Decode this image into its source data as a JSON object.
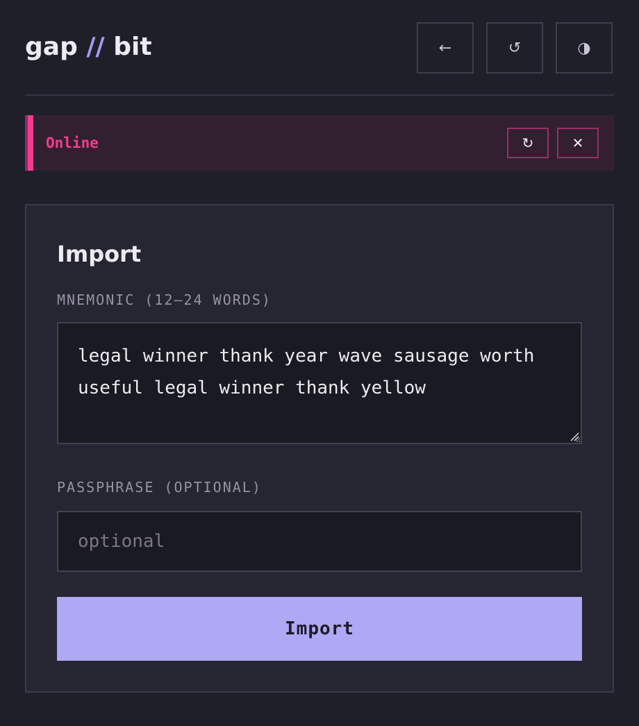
{
  "header": {
    "brand": {
      "left": "gap",
      "separator": "//",
      "right": "bit"
    },
    "buttons": [
      {
        "icon": "arrow-left-icon",
        "glyph": "←"
      },
      {
        "icon": "undo-icon",
        "glyph": "↺"
      },
      {
        "icon": "half-circle-theme-icon",
        "glyph": "◑"
      }
    ]
  },
  "banner": {
    "status": "Online",
    "refresh_glyph": "↻",
    "close_glyph": "✕",
    "accent_color": "#f03d8e"
  },
  "form": {
    "title": "Import",
    "mnemonic_label": "MNEMONIC (12–24 WORDS)",
    "mnemonic_value": "legal winner thank year wave sausage worth useful legal winner thank yellow",
    "passphrase_label": "PASSPHRASE (OPTIONAL)",
    "passphrase_value": "",
    "passphrase_placeholder": "optional",
    "submit_label": "Import",
    "submit_color": "#aea8f5"
  }
}
